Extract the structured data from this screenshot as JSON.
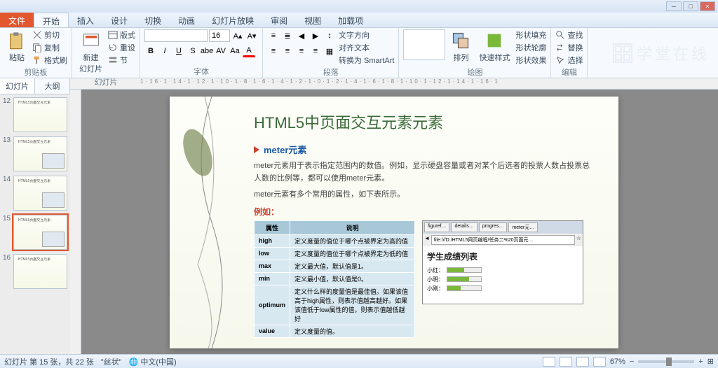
{
  "window": {
    "min": "─",
    "max": "□",
    "close": "×"
  },
  "tabs": {
    "file": "文件",
    "items": [
      "开始",
      "插入",
      "设计",
      "切换",
      "动画",
      "幻灯片放映",
      "审阅",
      "视图",
      "加载项"
    ],
    "active": 0
  },
  "ribbon": {
    "clipboard": {
      "label": "剪贴板",
      "paste": "粘贴",
      "cut": "剪切",
      "copy": "复制",
      "format": "格式刷"
    },
    "slides": {
      "label": "幻灯片",
      "new": "新建\n幻灯片",
      "layout": "版式",
      "reset": "重设",
      "section": "节"
    },
    "font": {
      "label": "字体",
      "size": "16"
    },
    "paragraph": {
      "label": "段落",
      "direction": "文字方向",
      "align": "对齐文本",
      "smartart": "转换为 SmartArt"
    },
    "drawing": {
      "label": "绘图",
      "arrange": "排列",
      "quick": "快速样式",
      "fill": "形状填充",
      "outline": "形状轮廓",
      "effects": "形状效果"
    },
    "editing": {
      "label": "编辑",
      "find": "查找",
      "replace": "替换",
      "select": "选择"
    }
  },
  "watermark": "学堂在线",
  "sidepanel": {
    "tabs": [
      "幻灯片",
      "大纲"
    ],
    "thumbs": [
      "12",
      "13",
      "14",
      "15",
      "16"
    ],
    "active": 3
  },
  "ruler": "1·16·1·14·1·12·1·10·1·8·1·6·1·4·1·2·1·0·1·2·1·4·1·6·1·8·1·10·1·12·1·14·1·16·1",
  "slide": {
    "title": "HTML5中页面交互元素元素",
    "bullet": "meter元素",
    "para1": "meter元素用于表示指定范围内的数值。例如，显示硬盘容量或者对某个后选者的投票人数占投票总人数的比例等，都可以使用meter元素。",
    "para2": "meter元素有多个常用的属性，如下表所示。",
    "example": "例如：",
    "table": {
      "headers": [
        "属性",
        "说明"
      ],
      "rows": [
        [
          "high",
          "定义度量的值位于哪个点被界定为高的值"
        ],
        [
          "low",
          "定义度量的值位于哪个点被界定为低的值"
        ],
        [
          "max",
          "定义最大值，默认值是1。"
        ],
        [
          "min",
          "定义最小值，默认值是0。"
        ],
        [
          "optimum",
          "定义什么样的度量值是最佳值。如果该值高于high属性，则表示值越高越好。如果该值低于low属性的值，则表示值越低越好"
        ],
        [
          "value",
          "定义度量的值。"
        ]
      ]
    },
    "browser": {
      "tabs": [
        "figuref…",
        "details…",
        "progres…",
        "meter元…"
      ],
      "url": "file:///D:/HTML5网页编程/任务二%20页面元…",
      "heading": "学生成绩列表",
      "students": [
        {
          "name": "小红：",
          "pct": 50
        },
        {
          "name": "小明：",
          "pct": 65
        },
        {
          "name": "小刚：",
          "pct": 40
        }
      ]
    }
  },
  "status": {
    "slide_info": "幻灯片 第 15 张，共 22 张",
    "theme": "\"丝状\"",
    "lang": "中文(中国)",
    "zoom": "67%"
  }
}
